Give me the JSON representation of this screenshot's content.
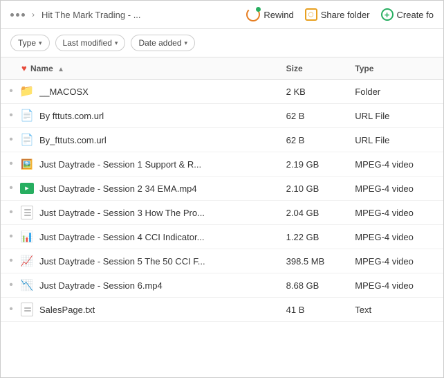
{
  "topbar": {
    "breadcrumb": "Hit The Mark Trading - ...",
    "rewind_label": "Rewind",
    "share_label": "Share folder",
    "create_label": "Create fo"
  },
  "filters": [
    {
      "label": "Type",
      "id": "type"
    },
    {
      "label": "Last modified",
      "id": "last-modified"
    },
    {
      "label": "Date added",
      "id": "date-added"
    }
  ],
  "table": {
    "columns": [
      {
        "id": "name",
        "label": "Name"
      },
      {
        "id": "size",
        "label": "Size"
      },
      {
        "id": "type",
        "label": "Type"
      }
    ],
    "rows": [
      {
        "name": "__MACOSX",
        "size": "2 KB",
        "type": "Folder",
        "icon": "folder"
      },
      {
        "name": "By fttuts.com.url",
        "size": "62 B",
        "type": "URL File",
        "icon": "file"
      },
      {
        "name": "By_fttuts.com.url",
        "size": "62 B",
        "type": "URL File",
        "icon": "file"
      },
      {
        "name": "Just Daytrade - Session 1 Support & R...",
        "size": "2.19 GB",
        "type": "MPEG-4 video",
        "icon": "video-thumb"
      },
      {
        "name": "Just Daytrade - Session 2 34 EMA.mp4",
        "size": "2.10 GB",
        "type": "MPEG-4 video",
        "icon": "video-green"
      },
      {
        "name": "Just Daytrade - Session 3 How The Pro...",
        "size": "2.04 GB",
        "type": "MPEG-4 video",
        "icon": "doc"
      },
      {
        "name": "Just Daytrade - Session 4 CCI Indicator...",
        "size": "1.22 GB",
        "type": "MPEG-4 video",
        "icon": "chart-lines"
      },
      {
        "name": "Just Daytrade - Session 5 The 50 CCI F...",
        "size": "398.5 MB",
        "type": "MPEG-4 video",
        "icon": "chart-grid"
      },
      {
        "name": "Just Daytrade - Session 6.mp4",
        "size": "8.68 GB",
        "type": "MPEG-4 video",
        "icon": "chart-lines2"
      },
      {
        "name": "SalesPage.txt",
        "size": "41 B",
        "type": "Text",
        "icon": "txt"
      }
    ]
  }
}
